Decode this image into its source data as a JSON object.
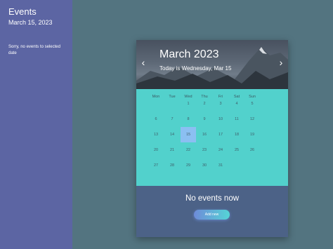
{
  "sidebar": {
    "title": "Events",
    "date": "March 15, 2023",
    "empty_message": "Sorry, no events to selected date"
  },
  "calendar": {
    "month_title": "March 2023",
    "today_text": "Today is Wednesday, Mar 15",
    "prev_icon": "chevron-left-icon",
    "next_icon": "chevron-right-icon",
    "weekdays": [
      "Mon",
      "Tue",
      "Wed",
      "Thu",
      "Fri",
      "Sat",
      "Sun"
    ],
    "first_weekday_index": 2,
    "days_in_month": 31,
    "selected_day": 15
  },
  "events": {
    "none_text": "No events now",
    "add_label": "Add new"
  },
  "colors": {
    "background": "#537480",
    "sidebar": "#5c65a3",
    "calendar_grid": "#52d1cc",
    "selected_day": "#8bbff2",
    "footer": "#4c6287"
  }
}
